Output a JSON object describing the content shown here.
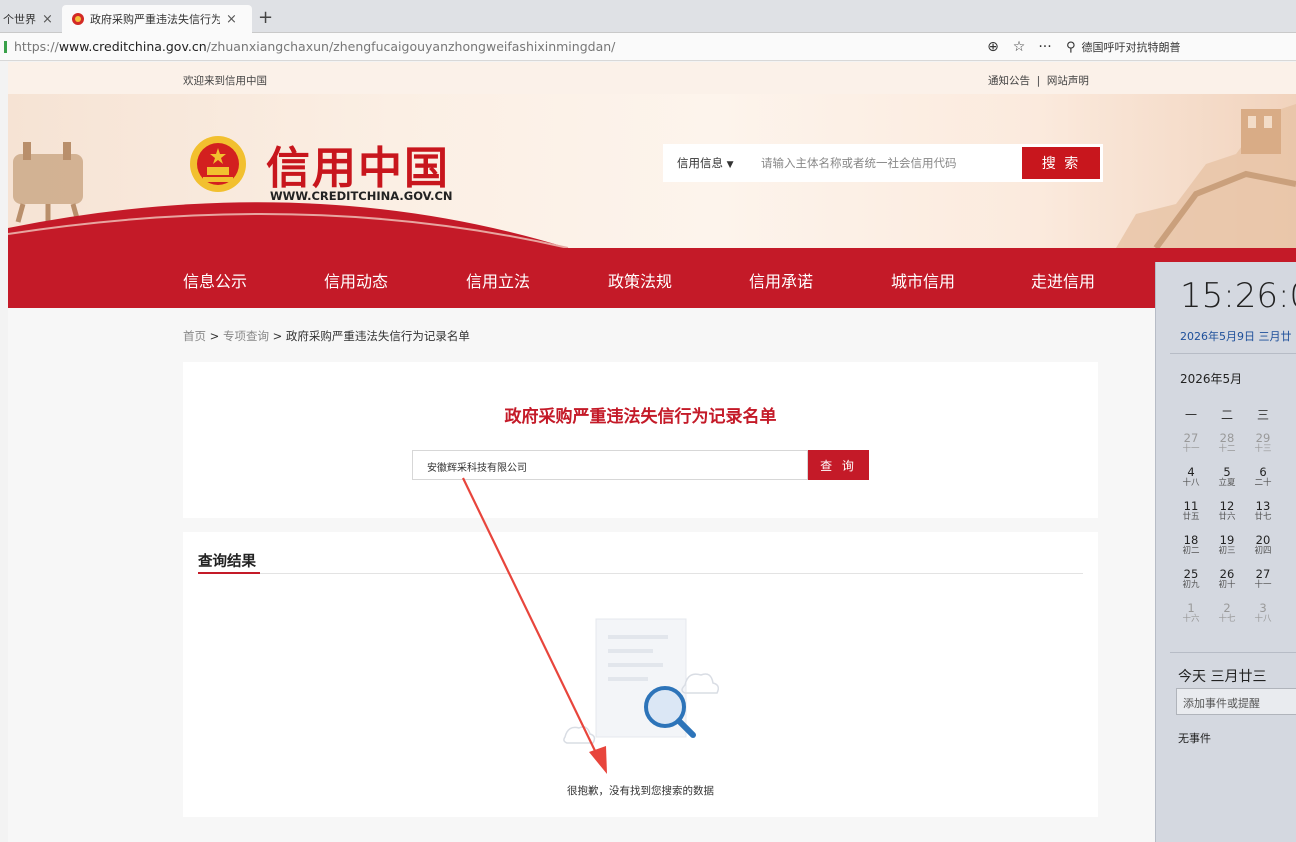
{
  "browser": {
    "tabs": [
      {
        "label": "个世界",
        "close": "×"
      },
      {
        "label": "政府采购严重违法失信行为记",
        "close": "×"
      }
    ],
    "new_tab": "+",
    "url_prefix": "https://",
    "url_host": "www.creditchina.gov.cn",
    "url_path": "/zhuanxiangchaxun/zhengfucaigouyanzhongweifashixinmingdan/",
    "search_text": "德国呼吁对抗特朗普"
  },
  "site": {
    "welcome": "欢迎来到信用中国",
    "top_links": "通知公告  |  网站声明",
    "logo_cn": "信用中国",
    "logo_en": "WWW.CREDITCHINA.GOV.CN",
    "search_category": "信用信息",
    "search_placeholder": "请输入主体名称或者统一社会信用代码",
    "search_button": "搜 索",
    "nav": [
      "信息公示",
      "信用动态",
      "信用立法",
      "政策法规",
      "信用承诺",
      "城市信用",
      "走进信用"
    ]
  },
  "breadcrumb": {
    "home": "首页",
    "sep1": " > ",
    "section": "专项查询",
    "sep2": " > ",
    "current": "政府采购严重违法失信行为记录名单"
  },
  "query": {
    "title": "政府采购严重违法失信行为记录名单",
    "input_value": "安徽辉采科技有限公司",
    "button": "查 询"
  },
  "results": {
    "heading": "查询结果",
    "empty_text": "很抱歉，没有找到您搜索的数据"
  },
  "calendar": {
    "time": "15:26:0",
    "date": "2026年5月9日 三月廿",
    "month": "2026年5月",
    "weekdays": [
      "一",
      "二",
      "三"
    ],
    "rows": [
      [
        {
          "d": "27",
          "l": "十一",
          "dim": true
        },
        {
          "d": "28",
          "l": "十二",
          "dim": true
        },
        {
          "d": "29",
          "l": "十三",
          "dim": true
        }
      ],
      [
        {
          "d": "4",
          "l": "十八"
        },
        {
          "d": "5",
          "l": "立夏"
        },
        {
          "d": "6",
          "l": "二十"
        }
      ],
      [
        {
          "d": "11",
          "l": "廿五"
        },
        {
          "d": "12",
          "l": "廿六"
        },
        {
          "d": "13",
          "l": "廿七"
        }
      ],
      [
        {
          "d": "18",
          "l": "初二"
        },
        {
          "d": "19",
          "l": "初三"
        },
        {
          "d": "20",
          "l": "初四"
        }
      ],
      [
        {
          "d": "25",
          "l": "初九"
        },
        {
          "d": "26",
          "l": "初十"
        },
        {
          "d": "27",
          "l": "十一"
        }
      ],
      [
        {
          "d": "1",
          "l": "十六",
          "dim": true
        },
        {
          "d": "2",
          "l": "十七",
          "dim": true
        },
        {
          "d": "3",
          "l": "十八",
          "dim": true
        }
      ]
    ],
    "today": "今天 三月廿三",
    "event_placeholder": "添加事件或提醒",
    "no_events": "无事件"
  },
  "colors": {
    "brand_red": "#c41a28",
    "nav_red": "#c41a28",
    "link_blue": "#1d4f9a"
  },
  "icons": [
    "magnifier-zoom-icon",
    "star-icon",
    "more-icon",
    "search-icon",
    "dropdown-icon",
    "emblem-icon"
  ]
}
